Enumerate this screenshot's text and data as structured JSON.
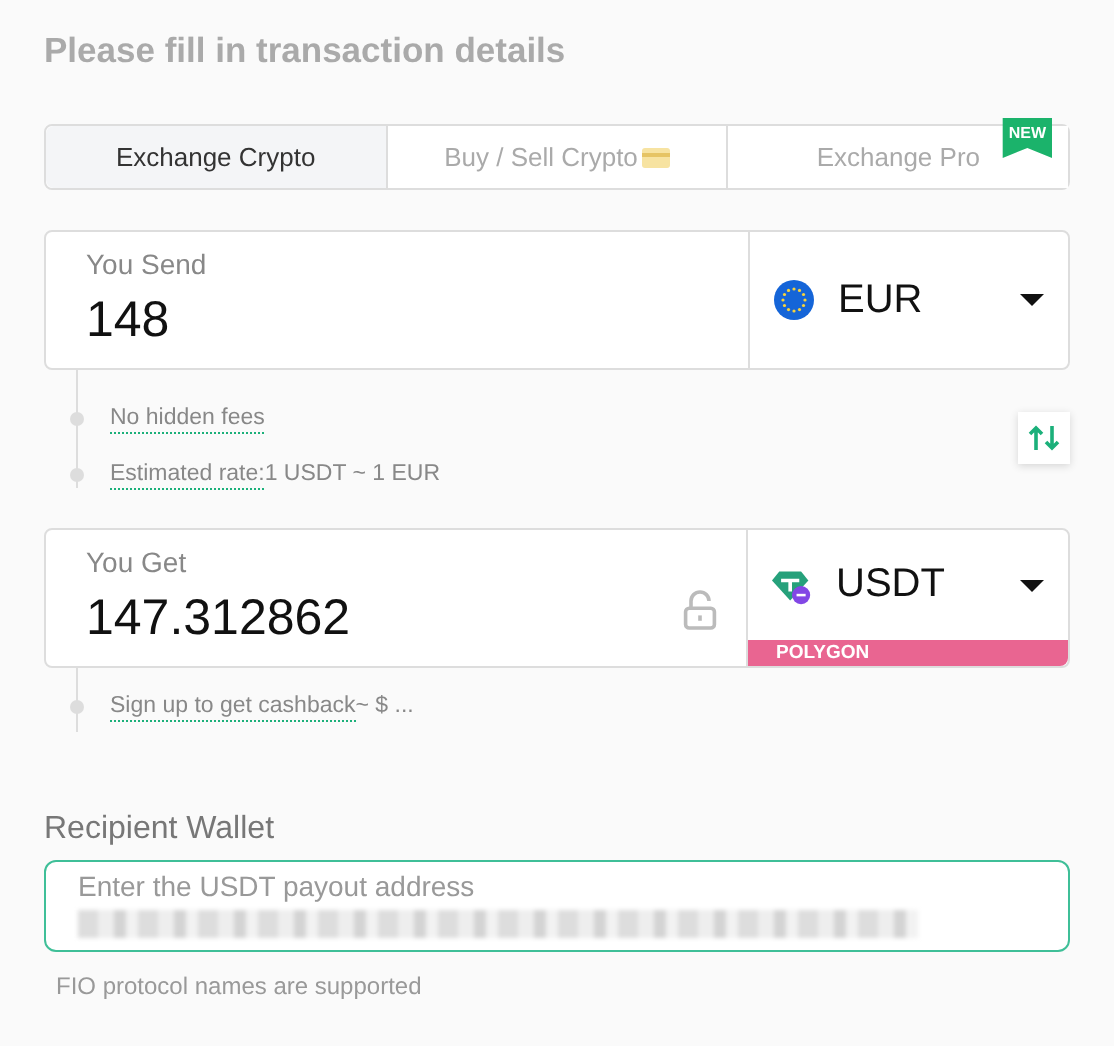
{
  "title": "Please fill in transaction details",
  "tabs": [
    {
      "label": "Exchange Crypto",
      "selected": true,
      "kind": "plain"
    },
    {
      "label": "Buy / Sell Crypto",
      "selected": false,
      "kind": "card"
    },
    {
      "label": "Exchange Pro",
      "selected": false,
      "kind": "plain",
      "badge": "NEW"
    }
  ],
  "send": {
    "label": "You Send",
    "value": "148",
    "currency": "EUR",
    "kind": "eur"
  },
  "info": [
    {
      "term": "No hidden fees"
    },
    {
      "term": "Estimated rate:",
      "detail": "1 USDT ~ 1 EUR"
    }
  ],
  "get": {
    "label": "You Get",
    "value": "147.312862",
    "currency": "USDT",
    "kind": "usdt",
    "network": "POLYGON",
    "locked": false
  },
  "cashback": {
    "term": "Sign up to get cashback",
    "detail": "~ $ ..."
  },
  "recipient": {
    "label": "Recipient Wallet",
    "placeholder": "Enter the USDT payout address",
    "hint": "FIO protocol names are supported"
  }
}
